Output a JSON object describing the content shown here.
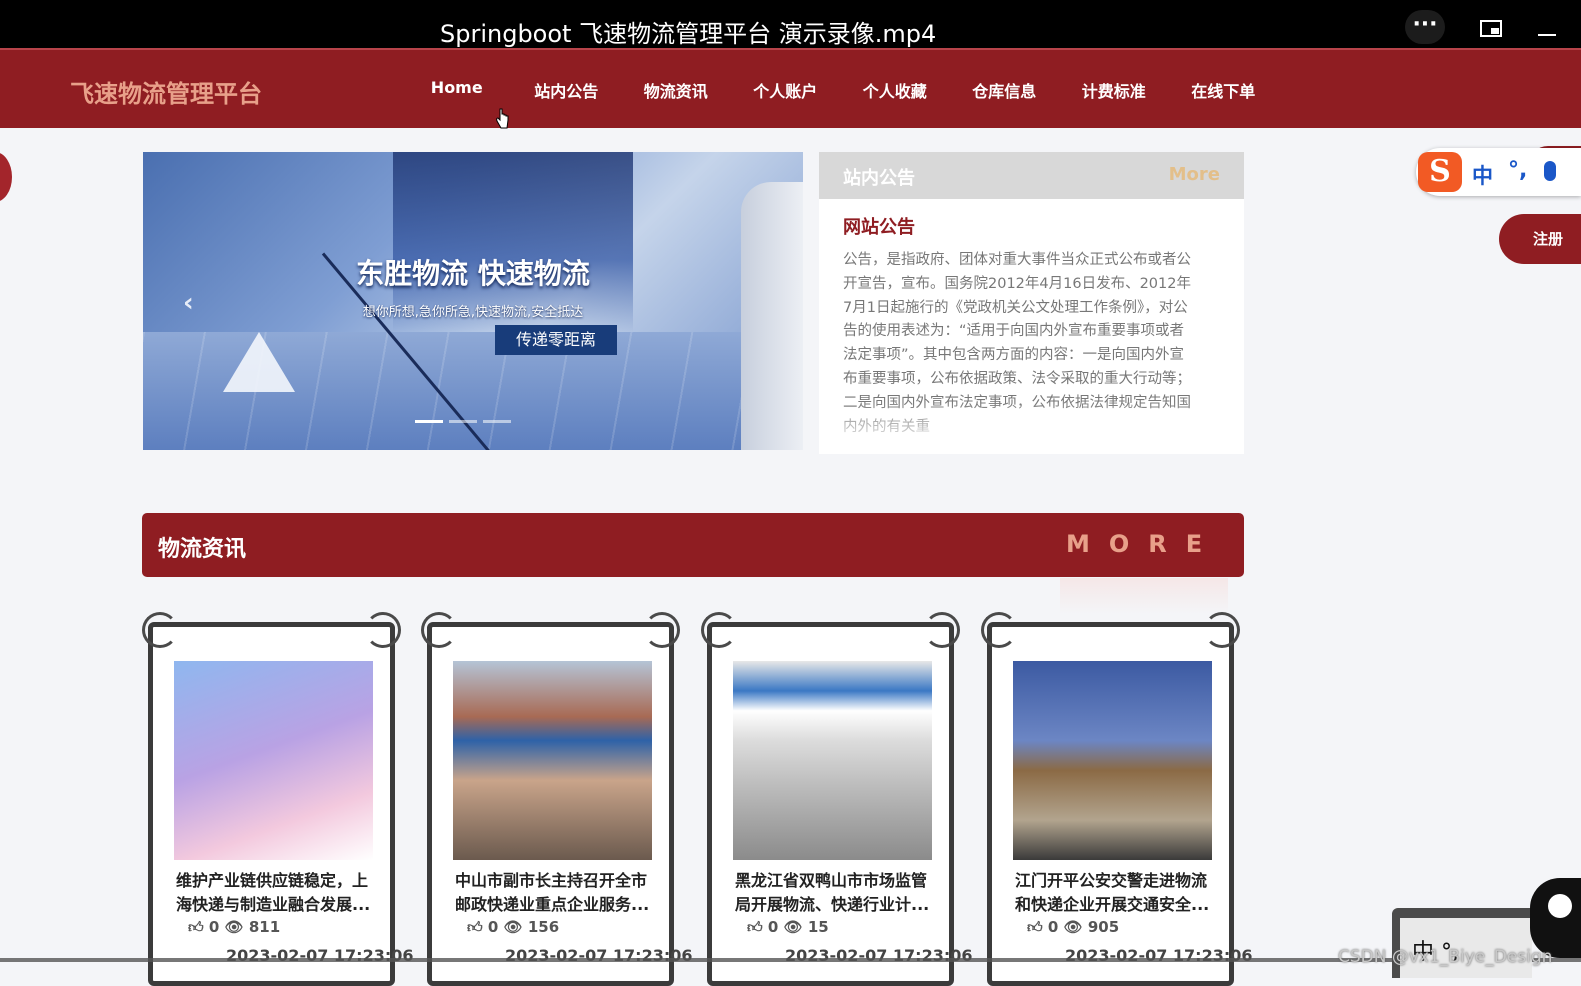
{
  "video": {
    "title": "Springboot 飞速物流管理平台 演示录像.mp4"
  },
  "site": {
    "brand": "飞速物流管理平台",
    "nav": [
      "Home",
      "站内公告",
      "物流资讯",
      "个人账户",
      "个人收藏",
      "仓库信息",
      "计费标准",
      "在线下单"
    ]
  },
  "carousel": {
    "title": "东胜物流 快速物流",
    "subtitle": "想你所想,急你所急,快速物流,安全抵达",
    "button": "传递零距离",
    "slides": 3,
    "active_slide": 1
  },
  "notice": {
    "heading": "站内公告",
    "more": "More",
    "title": "网站公告",
    "body": "公告，是指政府、团体对重大事件当众正式公布或者公开宣告，宣布。国务院2012年4月16日发布、2012年7月1日起施行的《党政机关公文处理工作条例》，对公告的使用表述为：“适用于向国内外宣布重要事项或者法定事项”。其中包含两方面的内容：一是向国内外宣布重要事项，公布依据政策、法令采取的重大行动等；二是向国内外宣布法定事项，公布依据法律规定告知国内外的有关重"
  },
  "news": {
    "heading": "物流资讯",
    "more": "MORE",
    "items": [
      {
        "title": "维护产业链供应链稳定，上海快递与制造业融合发展...",
        "likes": "0",
        "views": "811",
        "date": "2023-02-07 17:23:06",
        "image": "illustration-logistics"
      },
      {
        "title": "中山市副市长主持召开全市邮政快递业重点企业服务...",
        "likes": "0",
        "views": "156",
        "date": "2023-02-07 17:23:06",
        "image": "courier-storefront"
      },
      {
        "title": "黑龙江省双鸭山市市场监管局开展物流、快递行业计...",
        "likes": "0",
        "views": "15",
        "date": "2023-02-07 17:23:06",
        "image": "zto-express-store"
      },
      {
        "title": "江门开平公安交警走进物流和快递企业开展交通安全...",
        "likes": "0",
        "views": "905",
        "date": "2023-02-07 17:23:06",
        "image": "courier-with-box"
      }
    ]
  },
  "overlay": {
    "ime_logo": "S",
    "ime_lang": "中",
    "ime_punct": "°,",
    "register": "注册",
    "widget_text": "中 °,",
    "watermark": "CSDN @vx1_Biye_Design"
  },
  "colors": {
    "primary": "#8f1d22",
    "accent": "#e8a08a",
    "background": "#f4f5f8"
  }
}
